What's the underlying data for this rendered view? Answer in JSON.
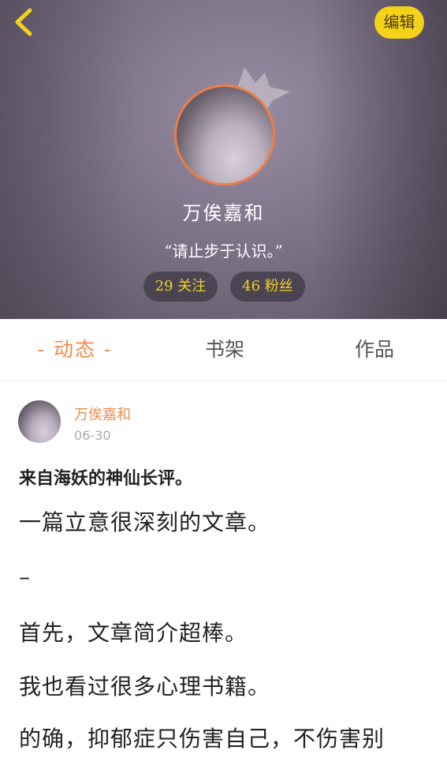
{
  "header": {
    "edit_label": "编辑",
    "name": "万俟嘉和",
    "motto": "“请止步于认识。”",
    "following": "29 关注",
    "fans": "46 粉丝",
    "accent_color": "#f4d21a"
  },
  "tabs": [
    {
      "label": "- 动态 -",
      "active": true
    },
    {
      "label": "书架",
      "active": false
    },
    {
      "label": "作品",
      "active": false
    }
  ],
  "post": {
    "author": "万俟嘉和",
    "date": "06-30",
    "title": "来自海妖的神仙长评。",
    "lines": [
      "一篇立意很深刻的文章。",
      "–",
      "首先，文章简介超棒。",
      "我也看过很多心理书籍。",
      "的确，抑郁症只伤害自己，不伤害别"
    ]
  },
  "colors": {
    "tab_active": "#f08a4b",
    "avatar_ring": "#ee7d48"
  }
}
